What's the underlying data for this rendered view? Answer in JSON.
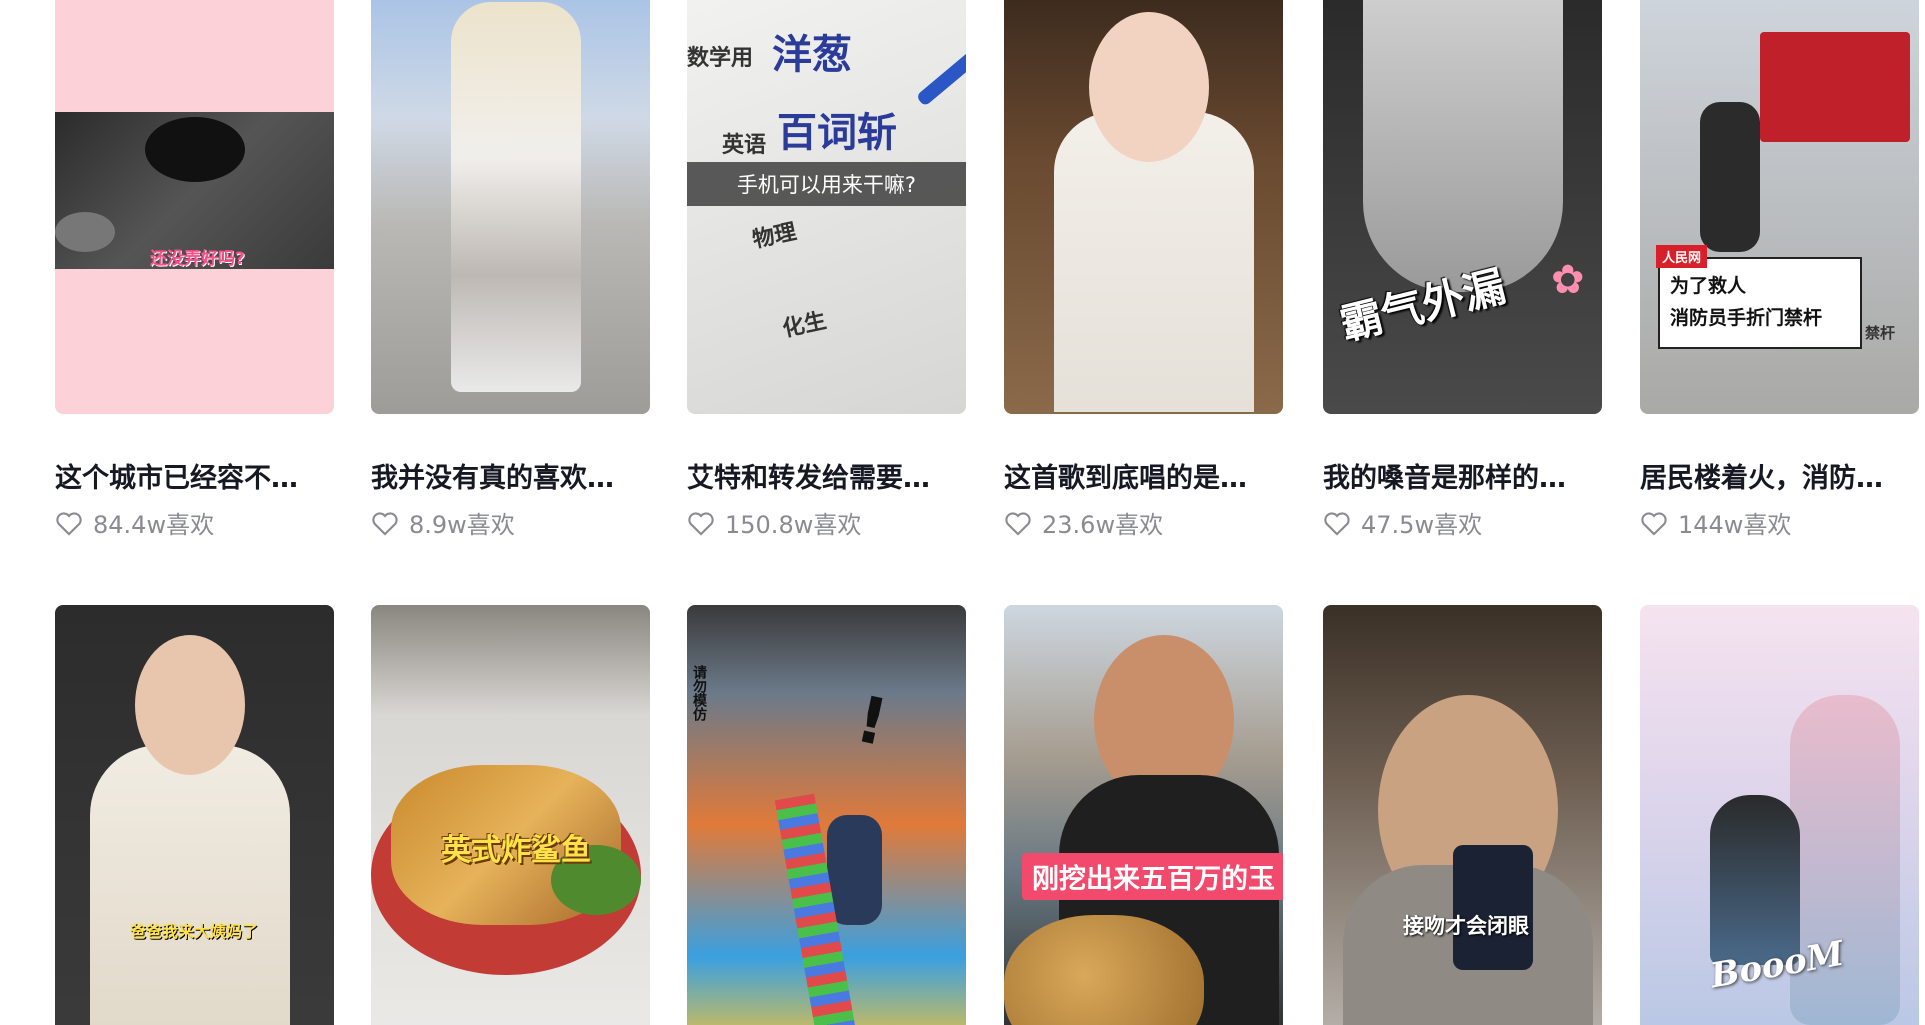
{
  "colors": {
    "caption": "#161823",
    "likes": "#8a8b91",
    "accent_pink": "#f14a6d"
  },
  "like_icon": "heart-outline-icon",
  "videos_row1": [
    {
      "caption": "这个城市已经容不…",
      "likes": "84.4w喜欢",
      "overlay": "还没弄好吗?"
    },
    {
      "caption": "我并没有真的喜欢…",
      "likes": "8.9w喜欢"
    },
    {
      "caption": "艾特和转发给需要…",
      "likes": "150.8w喜欢",
      "overlay": "手机可以用来干嘛?",
      "words": [
        "数学用",
        "洋葱",
        "英语",
        "百词斩",
        "物理",
        "化生"
      ]
    },
    {
      "caption": "这首歌到底唱的是…",
      "likes": "23.6w喜欢"
    },
    {
      "caption": "我的嗓音是那样的…",
      "likes": "47.5w喜欢",
      "overlay": "霸气外漏"
    },
    {
      "caption": "居民楼着火，消防…",
      "likes": "144w喜欢",
      "overlay_tag": "人民网",
      "overlay_lines": [
        "为了救人",
        "消防员手折门禁杆"
      ],
      "overlay_side": "禁杆"
    }
  ],
  "videos_row2": [
    {
      "overlay": "爸爸我来大姨妈了"
    },
    {
      "overlay": "英式炸鲨鱼"
    },
    {
      "overlay": "请勿模仿"
    },
    {
      "overlay": "刚挖出来五百万的玉"
    },
    {
      "overlay": "接吻才会闭眼"
    },
    {
      "overlay": "BoooM"
    }
  ]
}
